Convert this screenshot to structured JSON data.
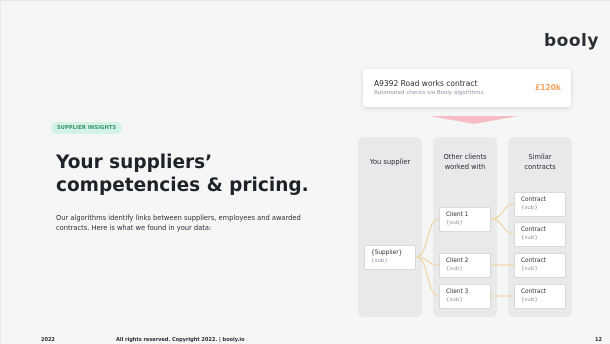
{
  "brand": {
    "logo": "booly"
  },
  "contract_card": {
    "title": "A9392 Road works contract",
    "subtitle": "Automated checks via Booly algorithms.",
    "value": "£120k"
  },
  "tag": "SUPPLIER INSIGHTS",
  "headline": {
    "line1": "Your suppliers’",
    "line2": "competencies & pricing."
  },
  "body": "Our algorithms identify links between suppliers, employees and awarded contracts. Here is what we found in your data:",
  "columns": {
    "supplier": {
      "heading": "You supplier"
    },
    "clients": {
      "heading_line1": "Other clients",
      "heading_line2": "worked with"
    },
    "contracts": {
      "heading_line1": "Similar",
      "heading_line2": "contracts"
    }
  },
  "supplier_box": {
    "title": "{Supplier}",
    "sub": "{sub}"
  },
  "clients": [
    {
      "title": "Client 1",
      "sub": "{sub}"
    },
    {
      "title": "Client 2",
      "sub": "{sub}"
    },
    {
      "title": "Client 3",
      "sub": "{sub}"
    }
  ],
  "contracts": [
    {
      "title": "Contract",
      "sub": "{sub}"
    },
    {
      "title": "Contract",
      "sub": "{sub}"
    },
    {
      "title": "Contract",
      "sub": "{sub}"
    },
    {
      "title": "Contract",
      "sub": "{sub}"
    }
  ],
  "footer": {
    "year": "2022",
    "copyright": "All rights reserved. Copyright 2022.  |  booly.io",
    "page": "12"
  },
  "colors": {
    "accent": "#f5a25a",
    "link": "#f2d6a8",
    "tag_bg": "#d2f3e5",
    "arrow": "#f8bcc4"
  }
}
